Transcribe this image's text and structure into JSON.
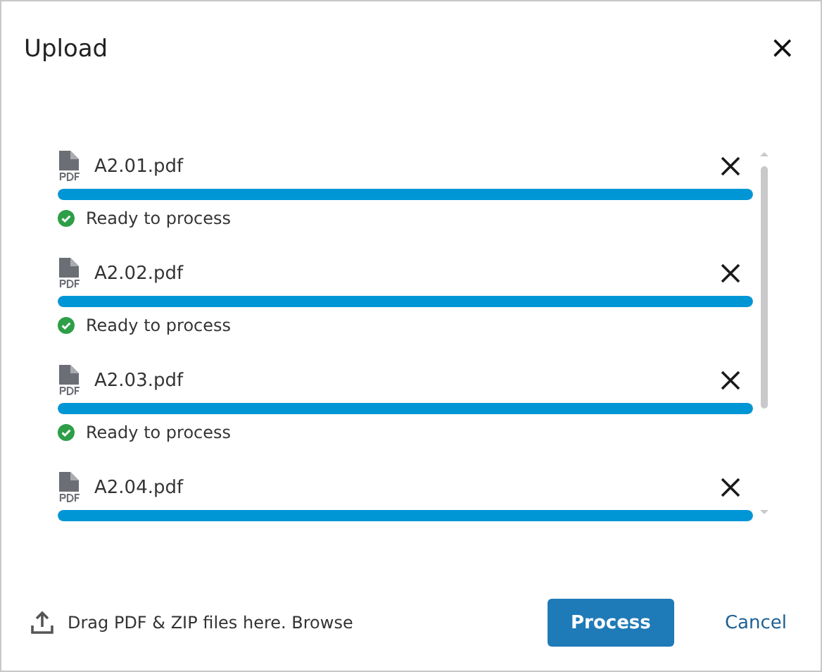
{
  "dialog": {
    "title": "Upload",
    "close": "×"
  },
  "files": [
    {
      "name": "A2.01.pdf",
      "level": 1,
      "status": "Ready to process"
    },
    {
      "name": "A2.02.pdf",
      "level": 1,
      "status": "Ready to process"
    },
    {
      "name": "A2.03.pdf",
      "level": 1,
      "status": "Ready to process"
    },
    {
      "name": "A2.04.pdf",
      "level": 1
    }
  ],
  "footer": {
    "drop_hint": "Drag PDF & ZIP files here. Browse",
    "buttons": [
      {
        "label": "Process",
        "kind": "primary"
      },
      {
        "label": "Cancel",
        "kind": "link"
      }
    ]
  }
}
